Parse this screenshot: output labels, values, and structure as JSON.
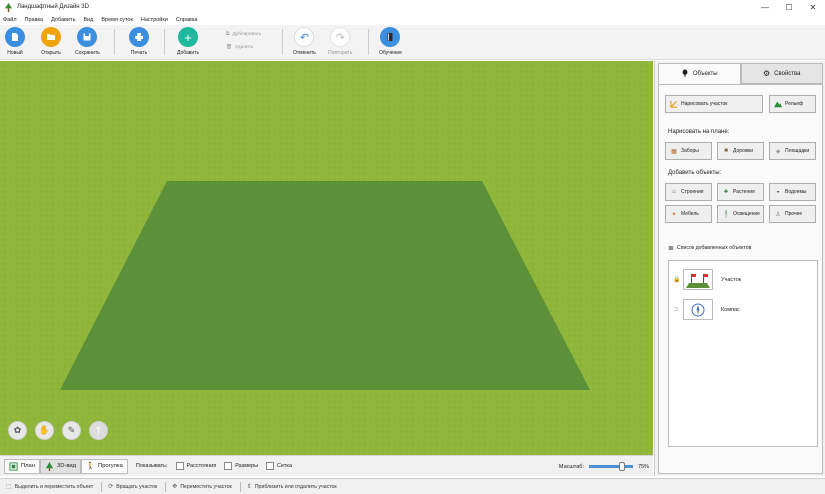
{
  "window": {
    "title": "Ландшафтный Дизайн 3D",
    "app_icon": "tree-icon",
    "min_glyph": "—",
    "max_glyph": "☐",
    "close_glyph": "✕"
  },
  "menu": [
    "Файл",
    "Правка",
    "Добавить",
    "Вид",
    "Время суток",
    "Настройки",
    "Справка"
  ],
  "toolbar": {
    "new": {
      "label": "Новый",
      "icon": "new-file-icon",
      "color": "#3c8ee0"
    },
    "open": {
      "label": "Открыть",
      "icon": "folder-icon",
      "color": "#f0a30a"
    },
    "save": {
      "label": "Сохранить",
      "icon": "floppy-icon",
      "color": "#3c8ee0"
    },
    "print": {
      "label": "Печать",
      "icon": "printer-icon",
      "color": "#3c8ee0"
    },
    "add": {
      "label": "Добавить",
      "icon": "plus-icon",
      "color": "#1fb9a0"
    },
    "duplicate": {
      "label": "Дублировать",
      "icon": "copy-icon"
    },
    "delete": {
      "label": "Удалить",
      "icon": "trash-icon"
    },
    "undo": {
      "label": "Отменить",
      "icon": "undo-icon",
      "color": "#3c8ee0"
    },
    "redo": {
      "label": "Повторить",
      "icon": "redo-icon",
      "color": "#bdbdbd"
    },
    "tutorial": {
      "label": "Обучение",
      "icon": "book-icon",
      "color": "#3c8ee0"
    }
  },
  "viewport": {
    "ground_color": "#8fb63a",
    "plot_color": "#5d9139",
    "tools": [
      "layers-icon",
      "hand-icon",
      "ruler-icon",
      "text-icon"
    ]
  },
  "bottom": {
    "views": [
      {
        "label": "План",
        "icon": "plan-icon"
      },
      {
        "label": "3D-вид",
        "icon": "tree-3d-icon"
      },
      {
        "label": "Прогулка",
        "icon": "walk-icon"
      }
    ],
    "show_label": "Показывать:",
    "toggles": [
      {
        "label": "Расстояния",
        "checked": false
      },
      {
        "label": "Размеры",
        "checked": false
      },
      {
        "label": "Сетка",
        "checked": false
      }
    ],
    "zoom_label": "Масштаб:",
    "zoom_value": "75%",
    "zoom_fraction": 0.75
  },
  "panel": {
    "tab_objects": "Объекты",
    "tab_properties": "Свойства",
    "draw_plot": "Нарисовать участок",
    "relief": "Рельеф",
    "draw_on_plan": "Нарисовать на плане:",
    "draw_items": [
      {
        "label": "Заборы",
        "icon": "fence-icon",
        "color": "#b5651d"
      },
      {
        "label": "Дорожки",
        "icon": "path-icon",
        "color": "#8b5a2b"
      },
      {
        "label": "Площадки",
        "icon": "tiles-icon",
        "color": "#888"
      }
    ],
    "add_objects": "Добавить объекты:",
    "object_items": [
      {
        "label": "Строения",
        "icon": "house-icon",
        "color": "#555"
      },
      {
        "label": "Растения",
        "icon": "plant-icon",
        "color": "#2e8b3a"
      },
      {
        "label": "Водоемы",
        "icon": "pond-icon",
        "color": "#444"
      },
      {
        "label": "Мебель",
        "icon": "furniture-icon",
        "color": "#c87b4a"
      },
      {
        "label": "Освещение",
        "icon": "lamp-icon",
        "color": "#2e8b3a"
      },
      {
        "label": "Прочее",
        "icon": "misc-icon",
        "color": "#777"
      }
    ],
    "list_title": "Список добавленных объектов",
    "list": [
      {
        "name": "Участок",
        "icon": "plot-thumb-icon",
        "locked": true
      },
      {
        "name": "Компас",
        "icon": "compass-icon",
        "locked": false
      }
    ]
  },
  "status": [
    "Выделить и переместить объект",
    "Вращать участок",
    "Переместить участок",
    "Приблизить или отдалить участок"
  ]
}
